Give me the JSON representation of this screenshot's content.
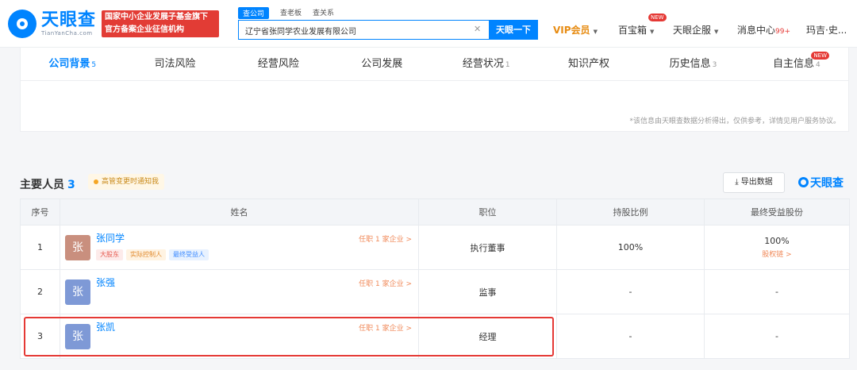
{
  "header": {
    "logo_name": "天眼查",
    "logo_sub": "TianYanCha.com",
    "promo_line1": "国家中小企业发展子基金旗下",
    "promo_line2": "官方备案企业征信机构",
    "search_tabs": [
      "查公司",
      "查老板",
      "查关系"
    ],
    "search_value": "辽宁省张同学农业发展有限公司",
    "search_button": "天眼一下",
    "nav": {
      "vip": "VIP会员",
      "treasure": "百宝箱",
      "treasure_badge": "NEW",
      "enterprise": "天眼企服",
      "messages": "消息中心",
      "messages_dot": "99+",
      "user": "玛吉·史..."
    }
  },
  "tabs": [
    {
      "label": "公司背景",
      "count": "5"
    },
    {
      "label": "司法风险",
      "count": ""
    },
    {
      "label": "经营风险",
      "count": ""
    },
    {
      "label": "公司发展",
      "count": ""
    },
    {
      "label": "经营状况",
      "count": "1"
    },
    {
      "label": "知识产权",
      "count": ""
    },
    {
      "label": "历史信息",
      "count": "3"
    },
    {
      "label": "自主信息",
      "count": "4"
    }
  ],
  "tab_badge": "NEW",
  "disclaimer": "*该信息由天眼查数据分析得出，仅供参考，详情见用户服务协议。",
  "people": {
    "title": "主要人员",
    "count": "3",
    "follow_text": "高管变更时通知我",
    "export_label": "导出数据",
    "brand": "天眼查",
    "columns": [
      "序号",
      "姓名",
      "职位",
      "持股比例",
      "最终受益股份"
    ],
    "rows": [
      {
        "index": "1",
        "avatar": "张",
        "name": "张同学",
        "tenure": "任职 1 家企业 >",
        "position": "执行董事",
        "share": "100%",
        "beneficial": "100%",
        "penetration": "股权链 >",
        "tags": [
          {
            "label": "大股东",
            "tone": "red"
          },
          {
            "label": "实际控制人",
            "tone": "orange"
          },
          {
            "label": "最终受益人",
            "tone": "blue"
          }
        ]
      },
      {
        "index": "2",
        "avatar": "张",
        "name": "张强",
        "tenure": "任职 1 家企业 >",
        "position": "监事",
        "share": "-",
        "beneficial": "-",
        "penetration": "",
        "tags": []
      },
      {
        "index": "3",
        "avatar": "张",
        "name": "张凯",
        "tenure": "任职 1 家企业 >",
        "position": "经理",
        "share": "-",
        "beneficial": "-",
        "penetration": "",
        "tags": []
      }
    ]
  },
  "colors": {
    "accent": "#0084ff",
    "avatar_1": "#c98f7e",
    "avatar_2": "#7e99d6",
    "avatar_3": "#7e99d6",
    "highlight": "#e53935"
  }
}
